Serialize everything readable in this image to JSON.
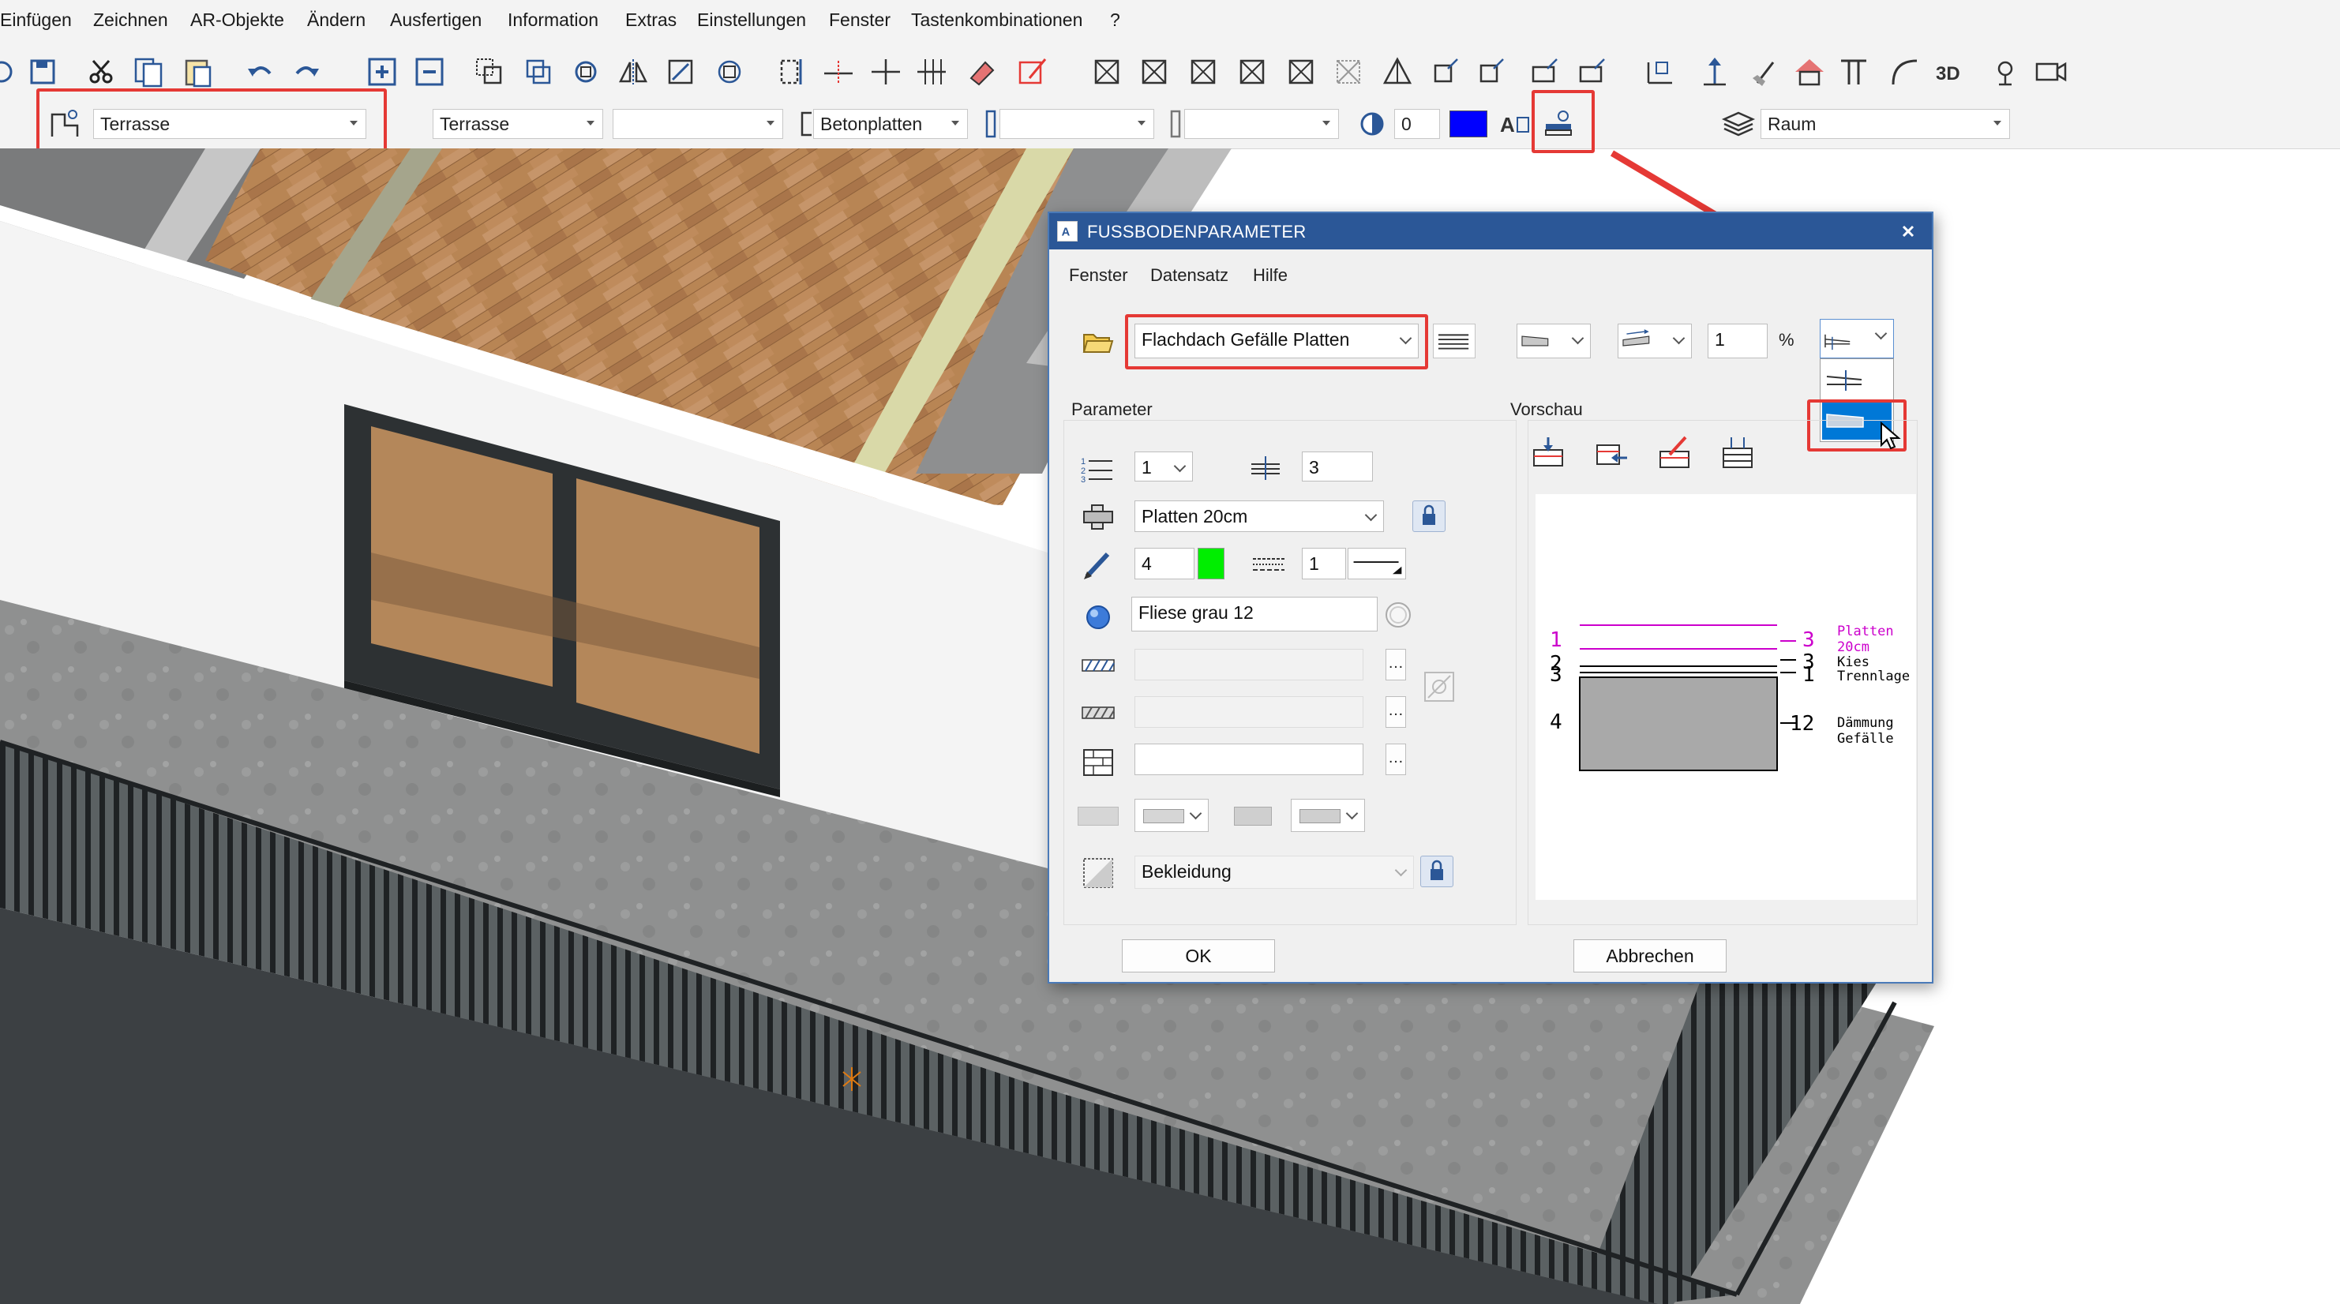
{
  "menu": {
    "items": [
      "Einfügen",
      "Zeichnen",
      "AR-Objekte",
      "Ändern",
      "Ausfertigen",
      "Information",
      "Extras",
      "Einstellungen",
      "Fenster",
      "Tastenkombinationen",
      "?"
    ]
  },
  "toolbar": {
    "type_select": "Terrasse",
    "name_select": "Terrasse",
    "empty_select": "",
    "material_select": "Betonplatten",
    "value_input": "0",
    "layer_select": "Raum",
    "color_swatch": "#0000ff",
    "highlight_color": "#e53935"
  },
  "dialog": {
    "title": "FUSSBODENPARAMETER",
    "menu": [
      "Fenster",
      "Datensatz",
      "Hilfe"
    ],
    "preset": "Flachdach Gefälle Platten",
    "slope_value": "1",
    "slope_unit": "%",
    "sections": {
      "parameter": "Parameter",
      "preview": "Vorschau"
    },
    "params": {
      "layer_index": "1",
      "layer_count": "3",
      "material": "Platten 20cm",
      "pen": "4",
      "pen_color": "#00ee00",
      "line_type": "1",
      "surface": "Fliese grau 12",
      "finish": "Bekleidung"
    },
    "buttons": {
      "ok": "OK",
      "cancel": "Abbrechen"
    },
    "preview": {
      "layers": [
        {
          "left": "1",
          "right": "3",
          "label": "Platten 20cm",
          "color": "#cc00cc"
        },
        {
          "left": "2",
          "right": "3",
          "label": "Kies",
          "color": "#000000"
        },
        {
          "left": "3",
          "right": "1",
          "label": "Trennlage",
          "color": "#000000"
        },
        {
          "left": "4",
          "right": "12",
          "label": "Dämmung Gefälle",
          "color": "#000000"
        }
      ]
    }
  }
}
